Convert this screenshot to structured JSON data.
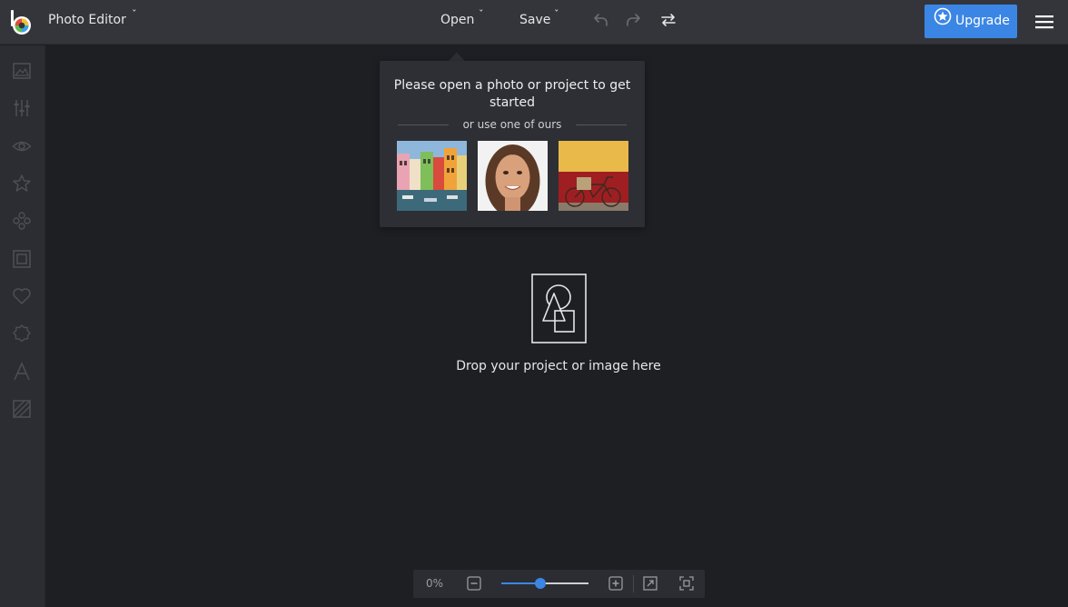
{
  "header": {
    "app_title": "Photo Editor",
    "open_label": "Open",
    "save_label": "Save",
    "upgrade_label": "Upgrade"
  },
  "sidebar": {
    "items": [
      "image-icon",
      "sliders-icon",
      "eye-icon",
      "star-icon",
      "effects-icon",
      "frame-icon",
      "heart-icon",
      "badge-icon",
      "text-icon",
      "texture-icon"
    ]
  },
  "popover": {
    "title": "Please open a photo or project to get started",
    "subtitle": "or use one of ours",
    "samples": [
      "buildings-thumbnail",
      "portrait-thumbnail",
      "bicycle-thumbnail"
    ]
  },
  "dropzone": {
    "text": "Drop your project or image here"
  },
  "zoom": {
    "value": "0%",
    "slider_fraction": 0.45
  },
  "colors": {
    "accent": "#3b86e5",
    "background": "#1e1f23",
    "topbar": "#34353a",
    "sidebar": "#2c2d32"
  }
}
